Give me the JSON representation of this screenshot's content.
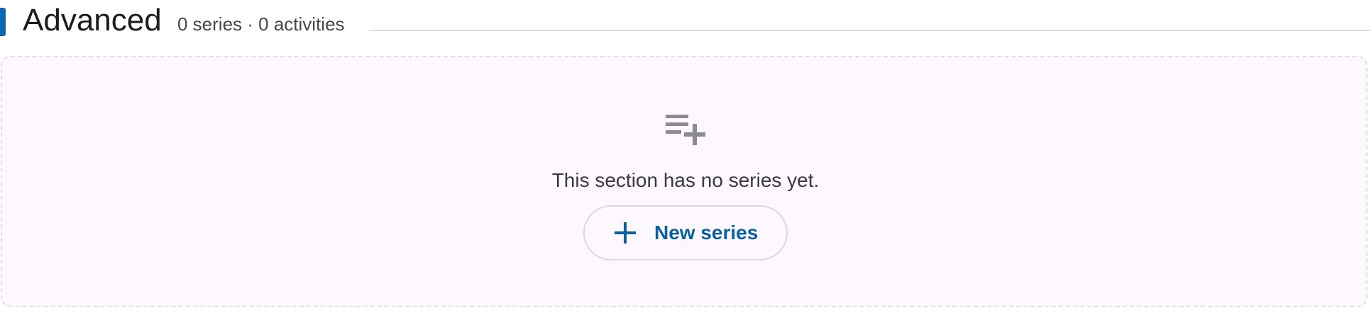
{
  "section": {
    "title": "Advanced",
    "subtitle": "0 series · 0 activities"
  },
  "empty_state": {
    "icon": "playlist-add-icon",
    "message": "This section has no series yet.",
    "new_series_button": {
      "icon": "plus-icon",
      "label": "New series"
    }
  },
  "colors": {
    "accent": "#0b67b2",
    "button_text": "#0b5f9e",
    "panel_background": "#fcf8fd"
  }
}
